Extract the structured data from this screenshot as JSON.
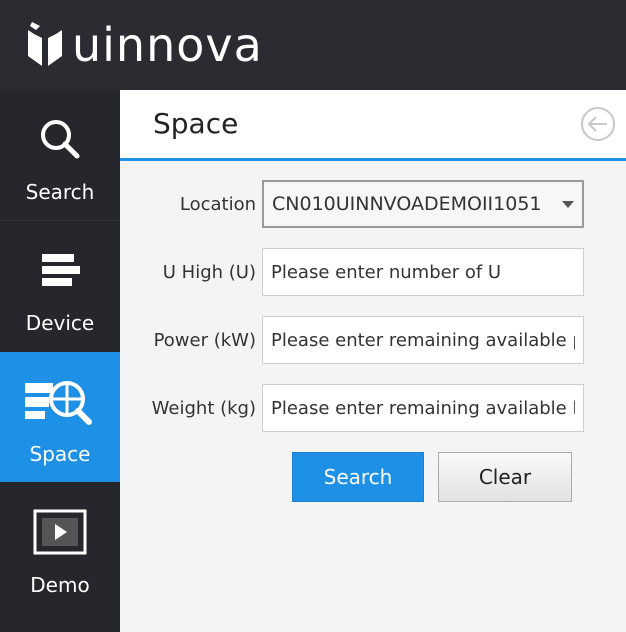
{
  "brand": {
    "name": "uinnova"
  },
  "nav": {
    "items": [
      {
        "label": "Search",
        "icon": "search-icon"
      },
      {
        "label": "Device",
        "icon": "device-icon"
      },
      {
        "label": "Space",
        "icon": "space-icon",
        "active": true
      },
      {
        "label": "Demo",
        "icon": "demo-icon"
      }
    ]
  },
  "panel": {
    "title": "Space",
    "back_icon": "back-arrow-icon"
  },
  "form": {
    "location": {
      "label": "Location",
      "value": "CN010UINNVOADEMOII1051"
    },
    "u_high": {
      "label": "U High (U)",
      "placeholder": "Please enter number of U",
      "value": ""
    },
    "power": {
      "label": "Power (kW)",
      "placeholder": "Please enter remaining available p",
      "value": ""
    },
    "weight": {
      "label": "Weight (kg)",
      "placeholder": "Please enter remaining available lc",
      "value": ""
    }
  },
  "buttons": {
    "search": "Search",
    "clear": "Clear"
  },
  "colors": {
    "accent": "#1e90e6",
    "topbar": "#2b2c31",
    "sidebar": "#26272c"
  }
}
